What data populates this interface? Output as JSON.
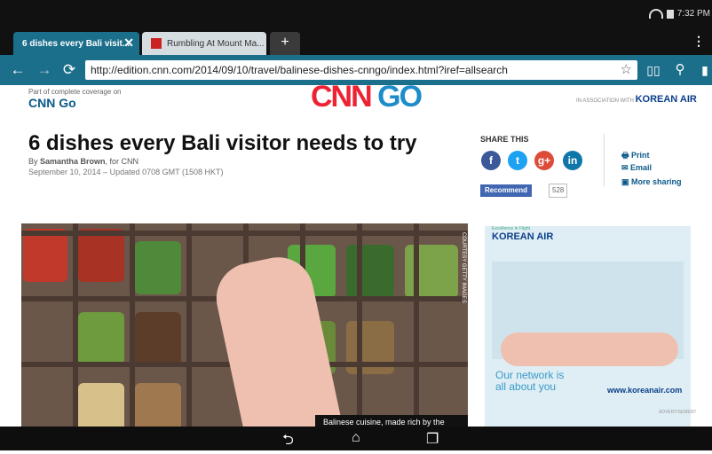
{
  "status": {
    "time": "7:32 PM"
  },
  "tabs": [
    {
      "title": "6 dishes every Bali visit...",
      "close": "✕"
    },
    {
      "title": "Rumbling At Mount Ma..."
    }
  ],
  "new_tab": "+",
  "toolbar": {
    "url": "http://edition.cnn.com/2014/09/10/travel/balinese-dishes-cnngo/index.html?iref=allsearch"
  },
  "header": {
    "subhead": "Part of complete coverage on",
    "section": "CNN Go",
    "logo_left": "CNN",
    "logo_right": "GO",
    "assoc_prefix": "IN ASSOCIATION WITH",
    "assoc_brand": "KOREAN AIR"
  },
  "article": {
    "title": "6 dishes every Bali visitor needs to try",
    "byline_prefix": "By",
    "author": "Samantha Brown",
    "byline_suffix": ", for CNN",
    "date": "September 10, 2014 – Updated 0708 GMT (1508 HKT)"
  },
  "share": {
    "title": "SHARE THIS",
    "recommend": "Recommend",
    "count": "528",
    "print": "Print",
    "email": "Email",
    "more": "More sharing"
  },
  "photo": {
    "caption": "Balinese cuisine, made rich by the",
    "credit": "COURTESY GETTY IMAGES"
  },
  "ad": {
    "pre": "Excellence in Flight",
    "logo": "KOREAN AIR",
    "line1": "Our network is",
    "line2": "all about you",
    "url": "www.koreanair.com",
    "tag": "ADVERTISEMENT"
  }
}
